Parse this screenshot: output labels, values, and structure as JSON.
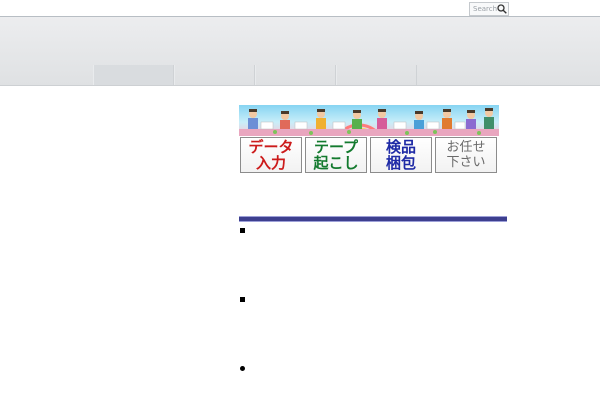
{
  "search": {
    "placeholder": "Search"
  },
  "icons": {
    "search": "magnifier-icon"
  },
  "banner": {
    "tiles": [
      {
        "line1": "データ",
        "line2": "入力"
      },
      {
        "line1": "テープ",
        "line2": "起こし"
      },
      {
        "line1": "検品",
        "line2": "梱包"
      },
      {
        "line1": "お任せ",
        "line2": "下さい"
      }
    ]
  },
  "colors": {
    "separator": "#3d3f8f",
    "tile_1": "#cc1b1b",
    "tile_2": "#137a2e",
    "tile_3": "#1e2aa6",
    "tile_4": "#6a6a6a"
  }
}
